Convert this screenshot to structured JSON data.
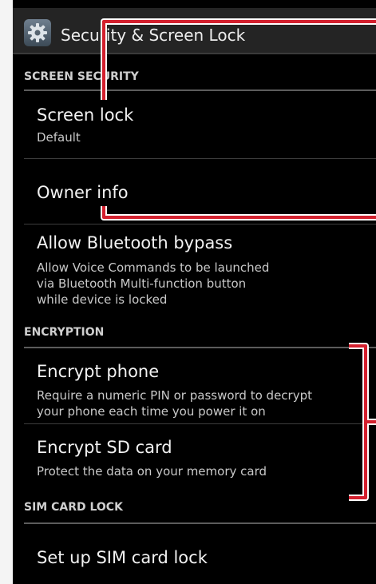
{
  "header": {
    "title": "Security & Screen Lock",
    "icon": "settings-gear-icon"
  },
  "sections": {
    "screen_security": "SCREEN SECURITY",
    "encryption": "ENCRYPTION",
    "sim_card_lock": "SIM CARD LOCK"
  },
  "items": {
    "screen_lock": {
      "title": "Screen lock",
      "subtitle": "Default"
    },
    "owner_info": {
      "title": "Owner info"
    },
    "bluetooth_bypass": {
      "title": "Allow Bluetooth bypass",
      "subtitle_lines": [
        "Allow Voice Commands to be launched",
        "via Bluetooth Multi-function button",
        "while device is locked"
      ]
    },
    "encrypt_phone": {
      "title": "Encrypt phone",
      "subtitle_lines": [
        "Require a numeric PIN or password to decrypt",
        "your phone each time you power it on"
      ]
    },
    "encrypt_sd": {
      "title": "Encrypt SD card",
      "subtitle": "Protect the data on your memory card"
    },
    "sim_lock": {
      "title": "Set up SIM card lock"
    }
  },
  "colors": {
    "background": "#000000",
    "text_primary": "#f2f2f2",
    "text_secondary": "#c9c9c9",
    "annotation_red": "#d3202e"
  }
}
